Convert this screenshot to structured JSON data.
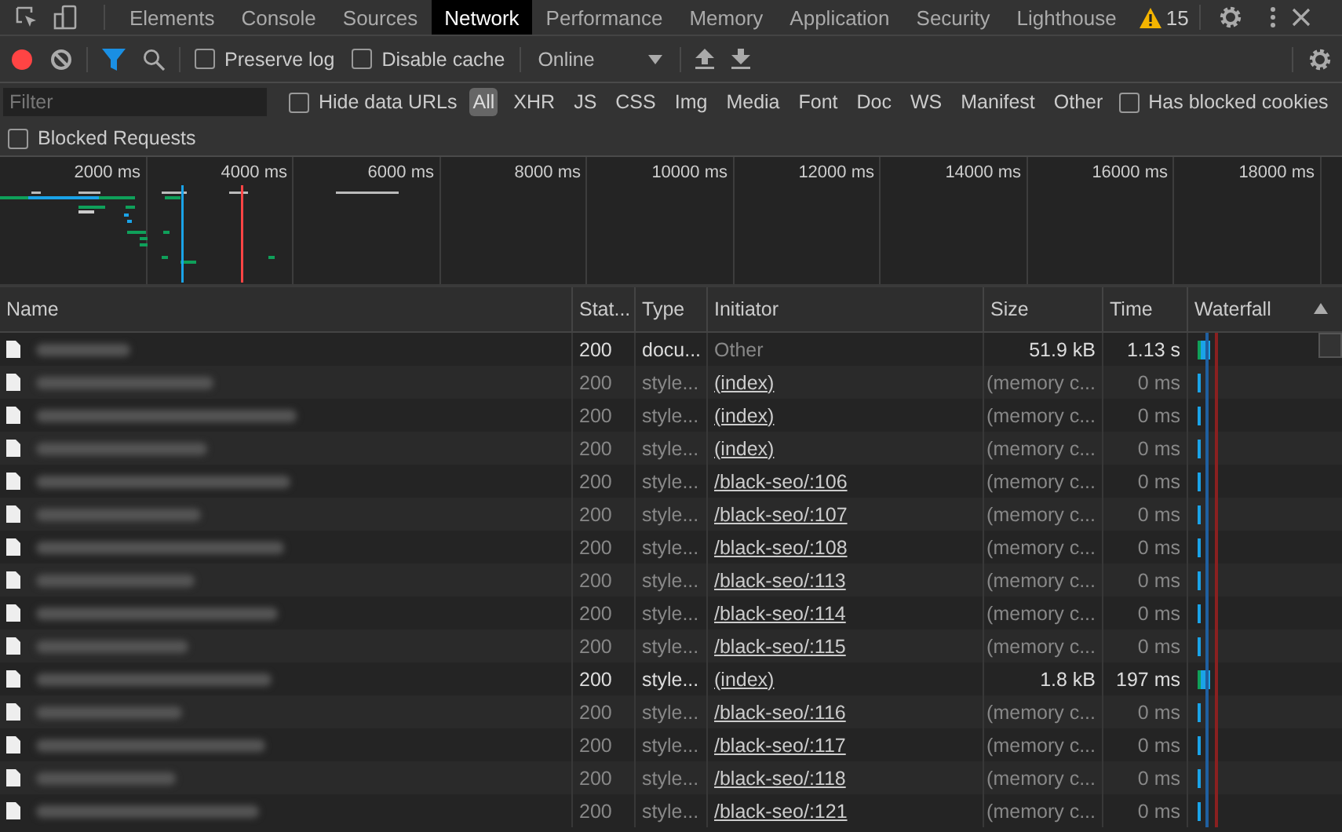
{
  "tabs": [
    {
      "label": "Elements",
      "selected": false
    },
    {
      "label": "Console",
      "selected": false
    },
    {
      "label": "Sources",
      "selected": false
    },
    {
      "label": "Network",
      "selected": true
    },
    {
      "label": "Performance",
      "selected": false
    },
    {
      "label": "Memory",
      "selected": false
    },
    {
      "label": "Application",
      "selected": false
    },
    {
      "label": "Security",
      "selected": false
    },
    {
      "label": "Lighthouse",
      "selected": false
    }
  ],
  "warnings": "15",
  "toolbar": {
    "recording": true,
    "filter_active": true,
    "preserve_log": {
      "label": "Preserve log",
      "checked": false
    },
    "disable_cache": {
      "label": "Disable cache",
      "checked": false
    },
    "throttling": "Online"
  },
  "filter_bar": {
    "placeholder": "Filter",
    "hide_data_urls": {
      "label": "Hide data URLs",
      "checked": false
    },
    "types": [
      {
        "label": "All",
        "selected": true
      },
      {
        "label": "XHR",
        "selected": false
      },
      {
        "label": "JS",
        "selected": false
      },
      {
        "label": "CSS",
        "selected": false
      },
      {
        "label": "Img",
        "selected": false
      },
      {
        "label": "Media",
        "selected": false
      },
      {
        "label": "Font",
        "selected": false
      },
      {
        "label": "Doc",
        "selected": false
      },
      {
        "label": "WS",
        "selected": false
      },
      {
        "label": "Manifest",
        "selected": false
      },
      {
        "label": "Other",
        "selected": false
      }
    ],
    "has_blocked_cookies": {
      "label": "Has blocked cookies",
      "checked": false
    },
    "blocked_requests": {
      "label": "Blocked Requests",
      "checked": false
    }
  },
  "overview": {
    "ticks": [
      "2000 ms",
      "4000 ms",
      "6000 ms",
      "8000 ms",
      "10000 ms",
      "12000 ms",
      "14000 ms",
      "16000 ms",
      "18000 ms"
    ]
  },
  "table": {
    "columns": [
      "Name",
      "Stat...",
      "Type",
      "Initiator",
      "Size",
      "Time",
      "Waterfall"
    ],
    "rows": [
      {
        "status": "200",
        "type": "docu...",
        "initiator": "Other",
        "initiator_link": false,
        "size": "51.9 kB",
        "time": "1.13 s",
        "cached": false
      },
      {
        "status": "200",
        "type": "style...",
        "initiator": "(index)",
        "initiator_link": true,
        "size": "(memory c...",
        "time": "0 ms",
        "cached": true
      },
      {
        "status": "200",
        "type": "style...",
        "initiator": "(index)",
        "initiator_link": true,
        "size": "(memory c...",
        "time": "0 ms",
        "cached": true
      },
      {
        "status": "200",
        "type": "style...",
        "initiator": "(index)",
        "initiator_link": true,
        "size": "(memory c...",
        "time": "0 ms",
        "cached": true
      },
      {
        "status": "200",
        "type": "style...",
        "initiator": "/black-seo/:106",
        "initiator_link": true,
        "size": "(memory c...",
        "time": "0 ms",
        "cached": true
      },
      {
        "status": "200",
        "type": "style...",
        "initiator": "/black-seo/:107",
        "initiator_link": true,
        "size": "(memory c...",
        "time": "0 ms",
        "cached": true
      },
      {
        "status": "200",
        "type": "style...",
        "initiator": "/black-seo/:108",
        "initiator_link": true,
        "size": "(memory c...",
        "time": "0 ms",
        "cached": true
      },
      {
        "status": "200",
        "type": "style...",
        "initiator": "/black-seo/:113",
        "initiator_link": true,
        "size": "(memory c...",
        "time": "0 ms",
        "cached": true
      },
      {
        "status": "200",
        "type": "style...",
        "initiator": "/black-seo/:114",
        "initiator_link": true,
        "size": "(memory c...",
        "time": "0 ms",
        "cached": true
      },
      {
        "status": "200",
        "type": "style...",
        "initiator": "/black-seo/:115",
        "initiator_link": true,
        "size": "(memory c...",
        "time": "0 ms",
        "cached": true
      },
      {
        "status": "200",
        "type": "style...",
        "initiator": "(index)",
        "initiator_link": true,
        "size": "1.8 kB",
        "time": "197 ms",
        "cached": false
      },
      {
        "status": "200",
        "type": "style...",
        "initiator": "/black-seo/:116",
        "initiator_link": true,
        "size": "(memory c...",
        "time": "0 ms",
        "cached": true
      },
      {
        "status": "200",
        "type": "style...",
        "initiator": "/black-seo/:117",
        "initiator_link": true,
        "size": "(memory c...",
        "time": "0 ms",
        "cached": true
      },
      {
        "status": "200",
        "type": "style...",
        "initiator": "/black-seo/:118",
        "initiator_link": true,
        "size": "(memory c...",
        "time": "0 ms",
        "cached": true
      },
      {
        "status": "200",
        "type": "style...",
        "initiator": "/black-seo/:121",
        "initiator_link": true,
        "size": "(memory c...",
        "time": "0 ms",
        "cached": true
      }
    ]
  }
}
